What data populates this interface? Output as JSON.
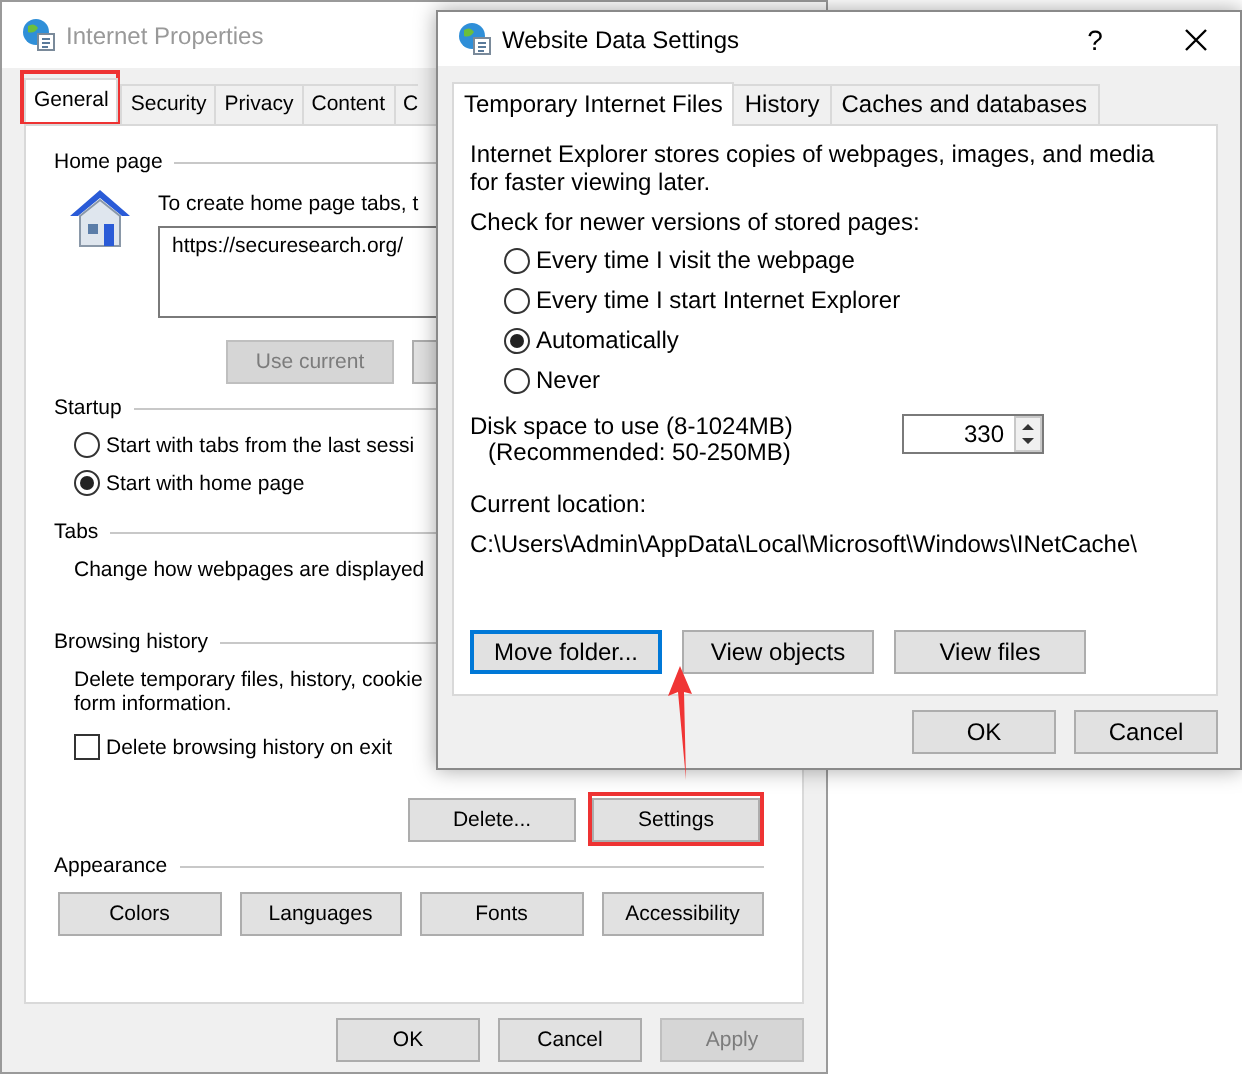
{
  "back_window": {
    "title": "Internet Properties",
    "tabs": [
      {
        "label": "General",
        "selected": true,
        "highlighted": true
      },
      {
        "label": "Security",
        "selected": false,
        "highlighted": false
      },
      {
        "label": "Privacy",
        "selected": false,
        "highlighted": false
      },
      {
        "label": "Content",
        "selected": false,
        "highlighted": false
      },
      {
        "label": "C",
        "selected": false,
        "highlighted": false
      }
    ],
    "home_page": {
      "heading": "Home page",
      "instruction": "To create home page tabs, t",
      "url": "https://securesearch.org/",
      "buttons": [
        {
          "label": "Use current",
          "disabled": true
        }
      ]
    },
    "startup": {
      "heading": "Startup",
      "options": [
        {
          "label": "Start with tabs from the last sessi",
          "selected": false
        },
        {
          "label": "Start with home page",
          "selected": true
        }
      ]
    },
    "tabs_section": {
      "heading": "Tabs",
      "description": "Change how webpages are displayed"
    },
    "browsing_history": {
      "heading": "Browsing history",
      "description_lines": [
        "Delete temporary files, history, cookie",
        "form information."
      ],
      "checkbox": {
        "label": "Delete browsing history on exit",
        "checked": false
      },
      "buttons": [
        {
          "label": "Delete...",
          "highlighted": false
        },
        {
          "label": "Settings",
          "highlighted": true
        }
      ]
    },
    "appearance": {
      "heading": "Appearance",
      "buttons": [
        "Colors",
        "Languages",
        "Fonts",
        "Accessibility"
      ]
    },
    "footer_buttons": [
      {
        "label": "OK",
        "disabled": false
      },
      {
        "label": "Cancel",
        "disabled": false
      },
      {
        "label": "Apply",
        "disabled": true
      }
    ]
  },
  "dialog": {
    "title": "Website Data Settings",
    "help": "?",
    "tabs": [
      {
        "label": "Temporary Internet Files",
        "selected": true
      },
      {
        "label": "History",
        "selected": false
      },
      {
        "label": "Caches and databases",
        "selected": false
      }
    ],
    "description": "Internet Explorer stores copies of webpages, images, and media for faster viewing later.",
    "check_label": "Check for newer versions of stored pages:",
    "options": [
      {
        "label": "Every time I visit the webpage",
        "selected": false
      },
      {
        "label": "Every time I start Internet Explorer",
        "selected": false
      },
      {
        "label": "Automatically",
        "selected": true
      },
      {
        "label": "Never",
        "selected": false
      }
    ],
    "disk_space_label": "Disk space to use (8-1024MB)",
    "recommended": "(Recommended: 50-250MB)",
    "disk_space_value": "330",
    "location_label": "Current location:",
    "location_path": "C:\\Users\\Admin\\AppData\\Local\\Microsoft\\Windows\\INetCache\\",
    "buttons": [
      {
        "label": "Move folder...",
        "focused": true
      },
      {
        "label": "View objects",
        "focused": false
      },
      {
        "label": "View files",
        "focused": false
      }
    ],
    "footer_buttons": [
      "OK",
      "Cancel"
    ]
  }
}
